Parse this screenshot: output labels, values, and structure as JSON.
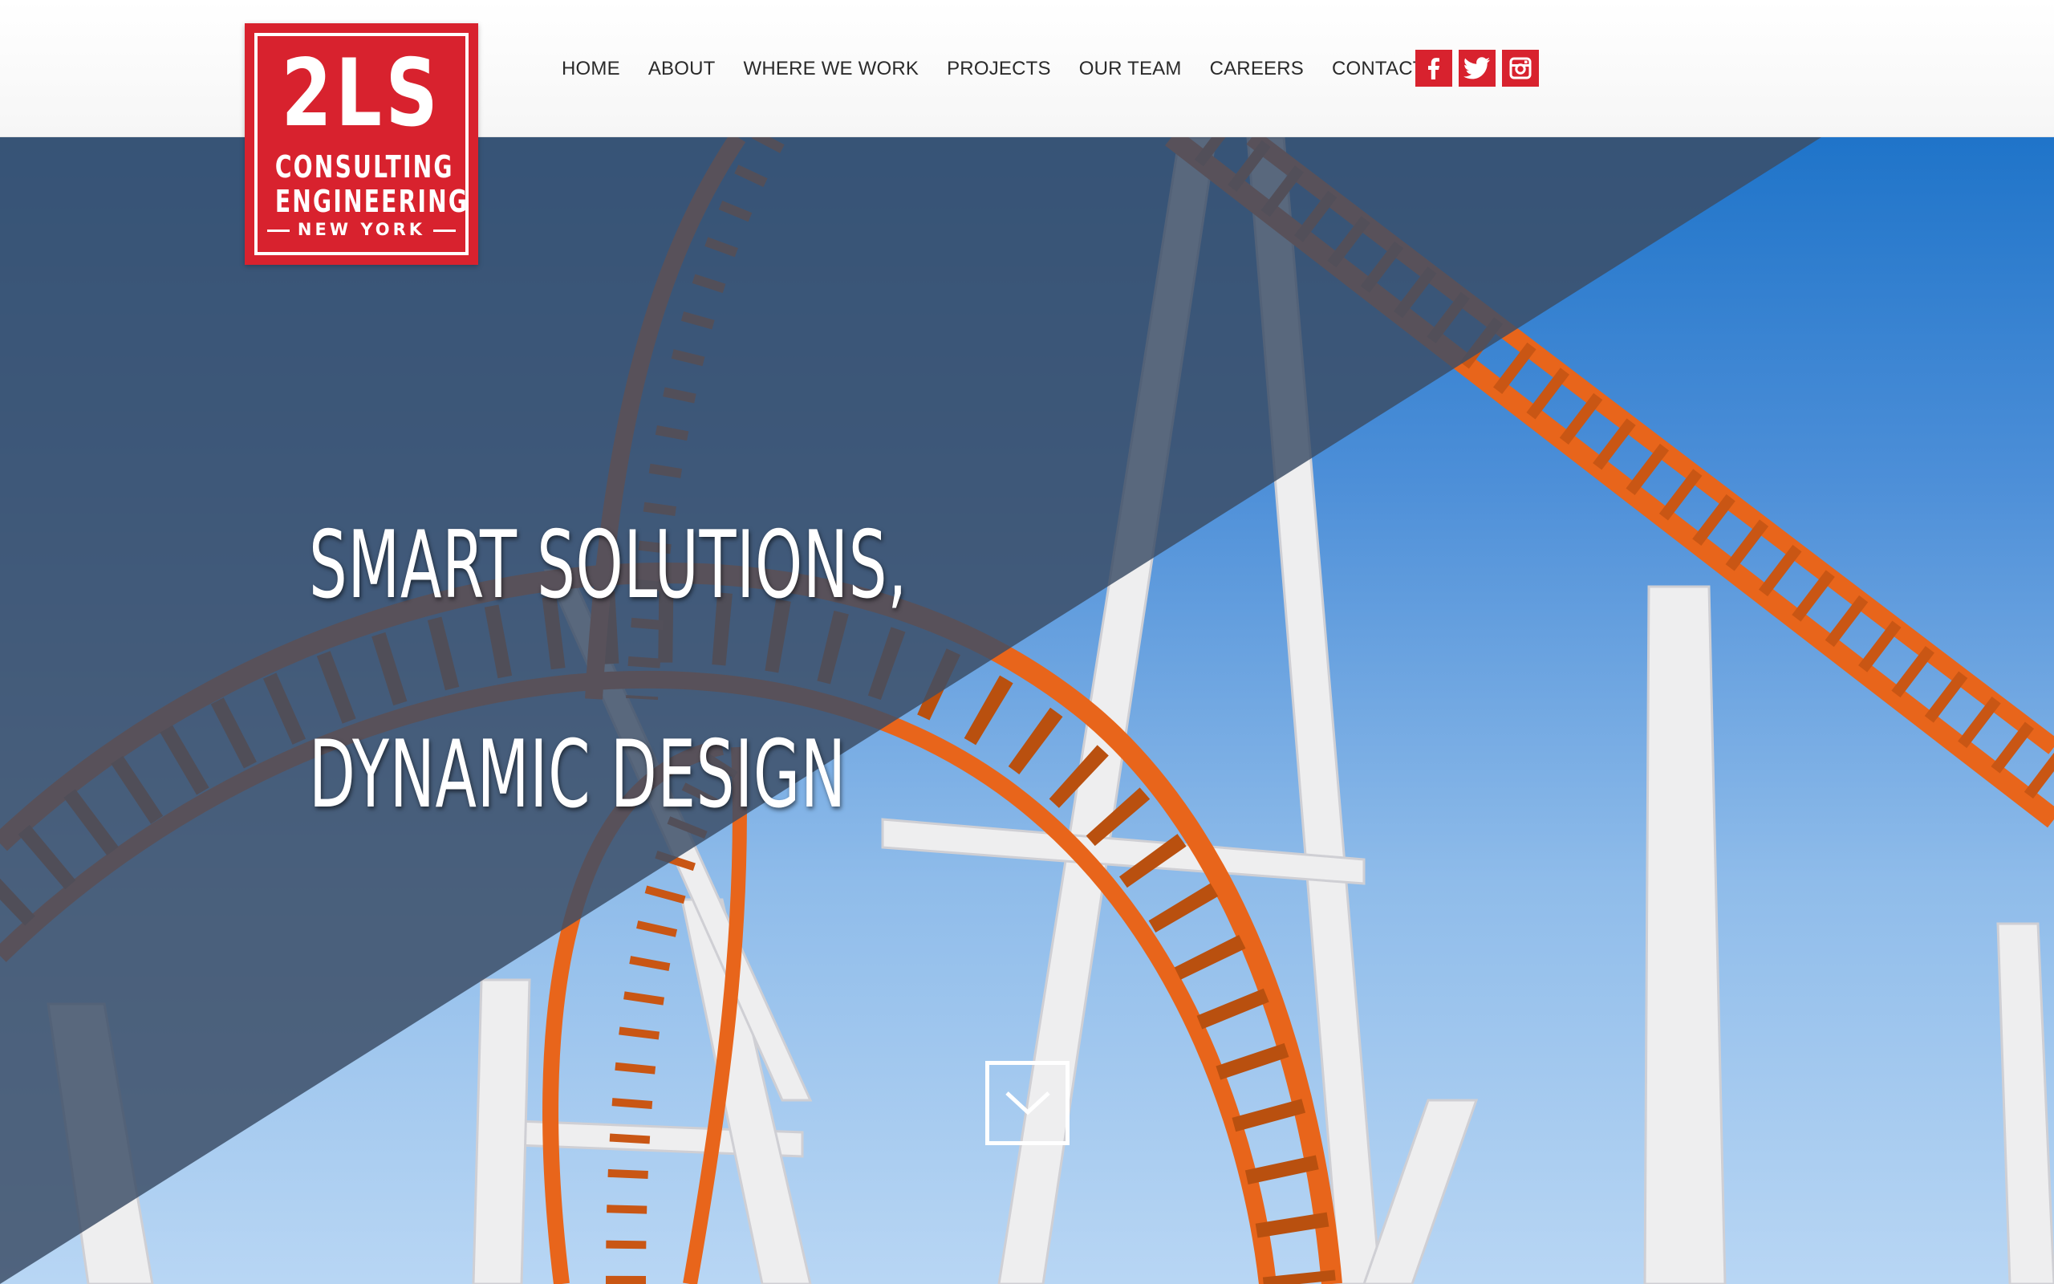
{
  "brand": {
    "logo_big": "2LS",
    "logo_line1": "CONSULTING",
    "logo_line2": "ENGINEERING",
    "logo_sub": "NEW YORK",
    "color": "#d8222e"
  },
  "nav": {
    "items": [
      {
        "label": "HOME"
      },
      {
        "label": "ABOUT"
      },
      {
        "label": "WHERE WE WORK"
      },
      {
        "label": "PROJECTS"
      },
      {
        "label": "OUR TEAM"
      },
      {
        "label": "CAREERS"
      },
      {
        "label": "CONTACT"
      }
    ]
  },
  "social": [
    {
      "icon": "facebook-icon"
    },
    {
      "icon": "twitter-icon"
    },
    {
      "icon": "instagram-icon"
    }
  ],
  "hero": {
    "headline_1": "SMART SOLUTIONS,",
    "headline_2": "DYNAMIC DESIGN",
    "scroll_icon": "chevron-down-icon",
    "overlay_color": "#3c4e66",
    "track_color": "#e8651b",
    "support_color": "#f2f2f2"
  }
}
